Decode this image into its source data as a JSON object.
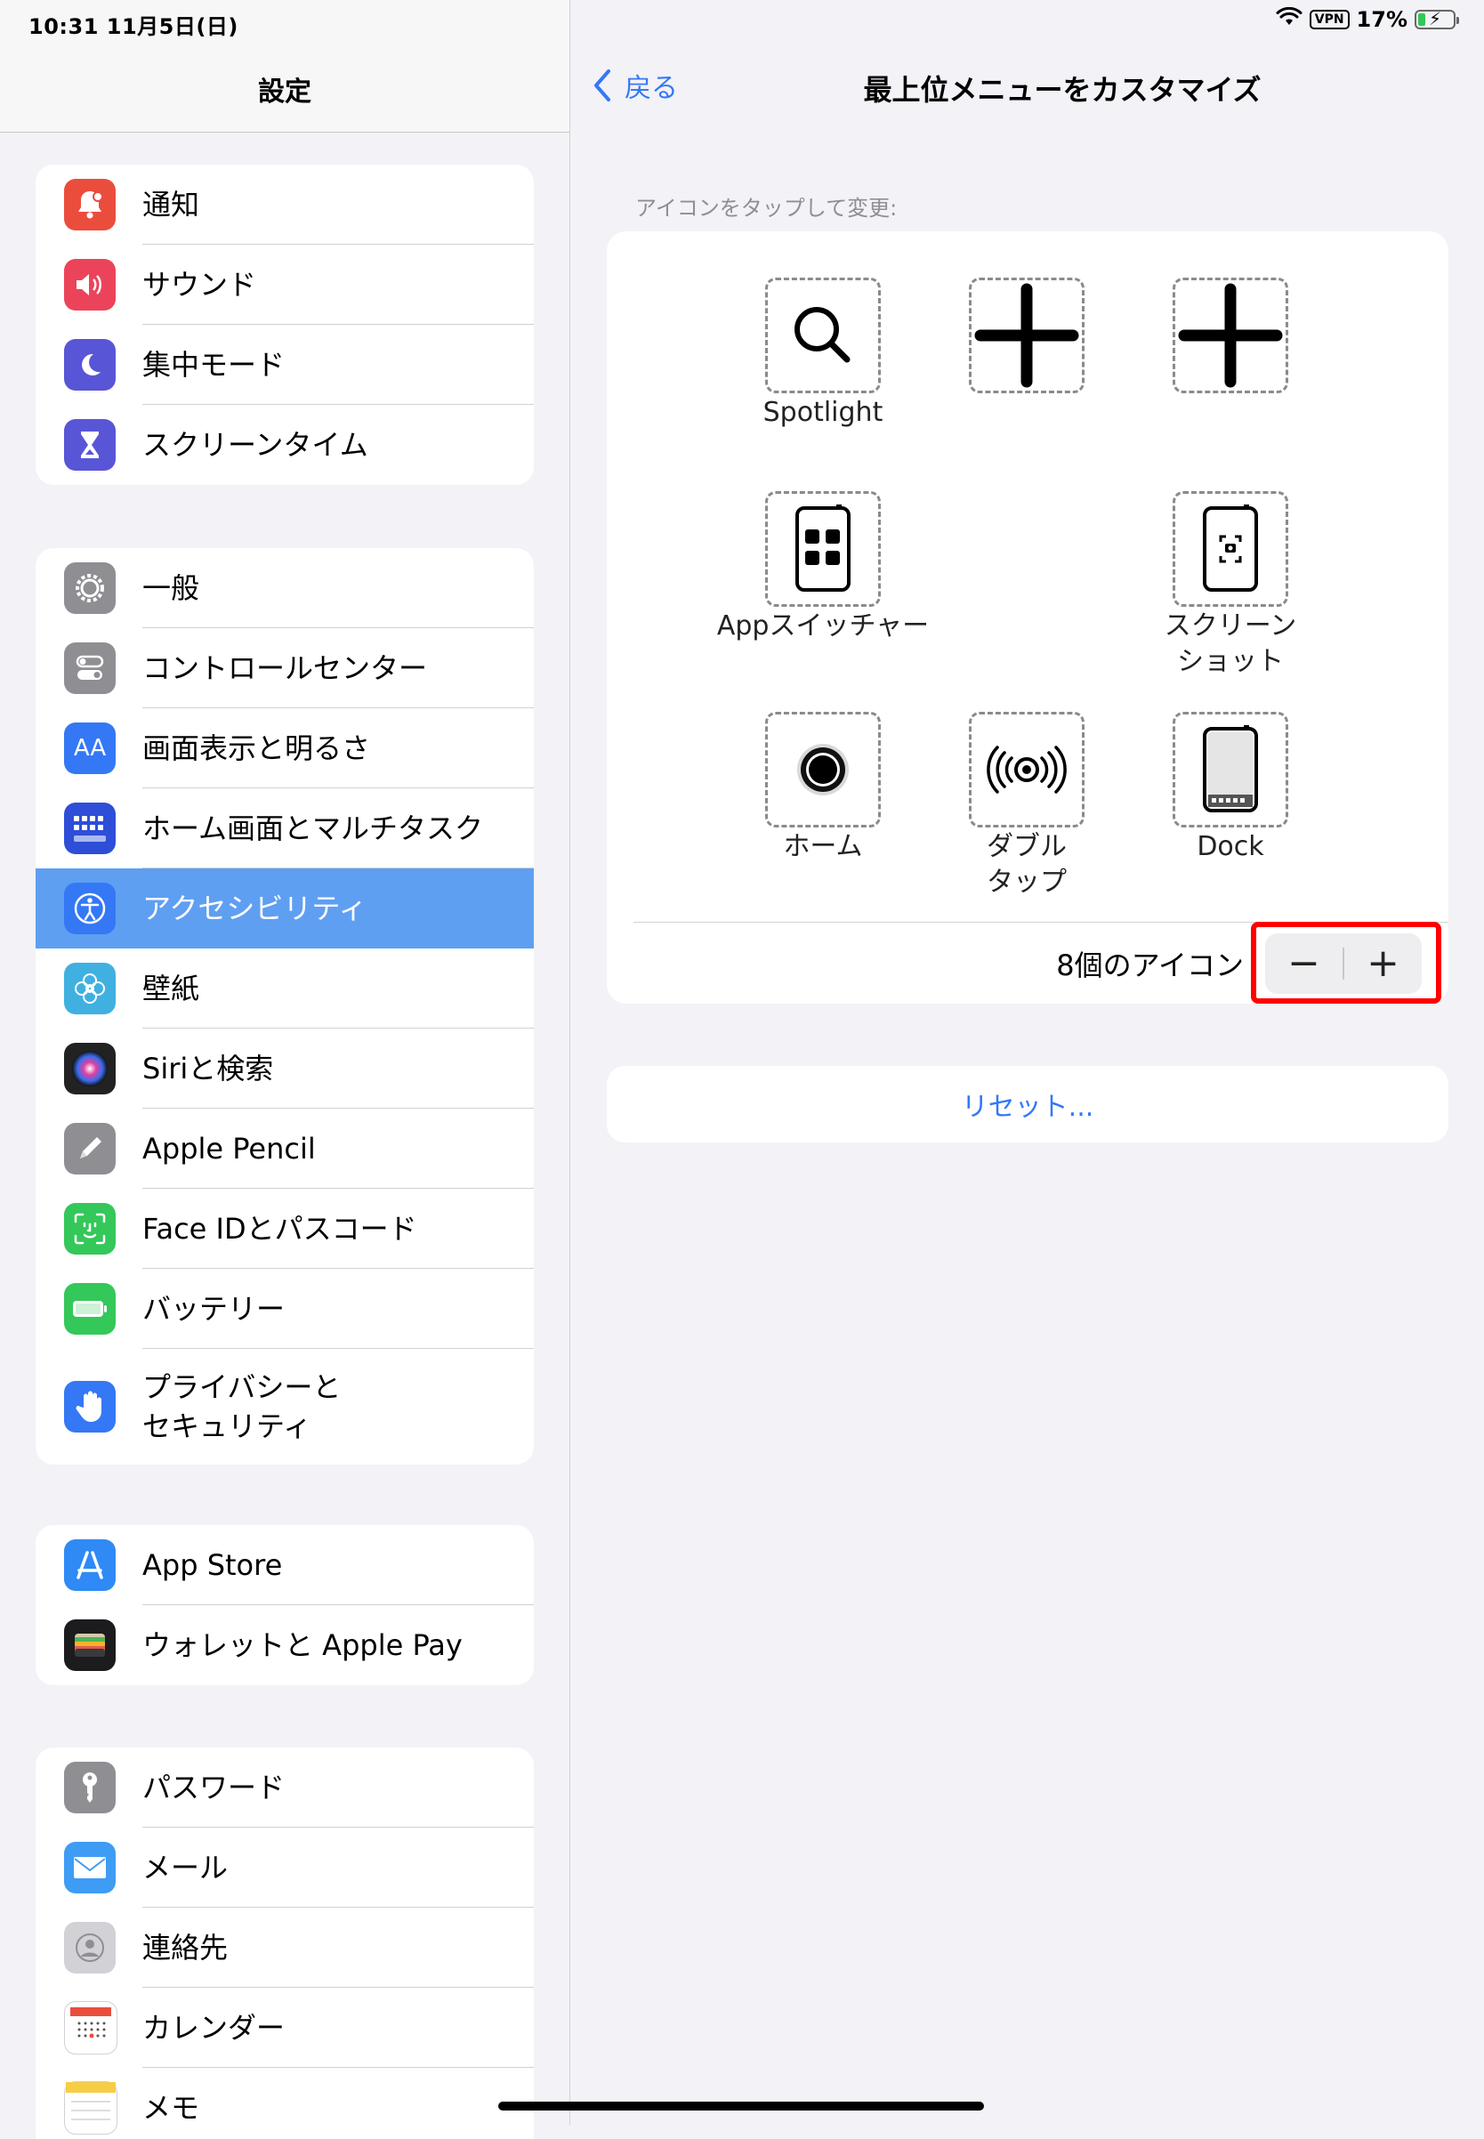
{
  "status": {
    "time_date": "10:31   11月5日(日)",
    "vpn": "VPN",
    "battery_percent": "17%"
  },
  "sidebar": {
    "title": "設定",
    "groups": [
      {
        "items": [
          {
            "label": "通知",
            "icon": "bell-icon",
            "color": "#eb4d3d"
          },
          {
            "label": "サウンド",
            "icon": "speaker-icon",
            "color": "#eb445a"
          },
          {
            "label": "集中モード",
            "icon": "moon-icon",
            "color": "#5856d6"
          },
          {
            "label": "スクリーンタイム",
            "icon": "hourglass-icon",
            "color": "#5856d6"
          }
        ]
      },
      {
        "items": [
          {
            "label": "一般",
            "icon": "gear-icon",
            "color": "#8e8e93"
          },
          {
            "label": "コントロールセンター",
            "icon": "toggles-icon",
            "color": "#8e8e93"
          },
          {
            "label": "画面表示と明るさ",
            "icon": "text-size-icon",
            "color": "#3478f6"
          },
          {
            "label": "ホーム画面とマルチタスク",
            "icon": "grid-icon",
            "color": "#2e4ed8"
          },
          {
            "label": "アクセシビリティ",
            "icon": "accessibility-icon",
            "color": "#3478f6",
            "selected": true
          },
          {
            "label": "壁紙",
            "icon": "flower-icon",
            "color": "#40b0e0"
          },
          {
            "label": "Siriと検索",
            "icon": "siri-icon",
            "color": "#222222"
          },
          {
            "label": "Apple Pencil",
            "icon": "pencil-icon",
            "color": "#8e8e93"
          },
          {
            "label": "Face IDとパスコード",
            "icon": "face-id-icon",
            "color": "#34c759"
          },
          {
            "label": "バッテリー",
            "icon": "battery-icon",
            "color": "#34c759"
          },
          {
            "label": "プライバシーと\nセキュリティ",
            "icon": "hand-icon",
            "color": "#3478f6"
          }
        ]
      },
      {
        "items": [
          {
            "label": "App Store",
            "icon": "app-store-icon",
            "color": "#2f8af5"
          },
          {
            "label": "ウォレットと Apple Pay",
            "icon": "wallet-icon",
            "color": "#1c1c1e"
          }
        ]
      },
      {
        "items": [
          {
            "label": "パスワード",
            "icon": "key-icon",
            "color": "#8e8e93"
          },
          {
            "label": "メール",
            "icon": "mail-icon",
            "color": "#3e9cf5"
          },
          {
            "label": "連絡先",
            "icon": "contacts-icon",
            "color": "#b0b0b5"
          },
          {
            "label": "カレンダー",
            "icon": "calendar-icon",
            "color": "#ffffff"
          },
          {
            "label": "メモ",
            "icon": "notes-icon",
            "color": "#ffffff"
          }
        ]
      }
    ]
  },
  "detail": {
    "back_label": "戻る",
    "title": "最上位メニューをカスタマイズ",
    "hint": "アイコンをタップして変更:",
    "slots": [
      {
        "label": "Spotlight",
        "icon": "search-icon"
      },
      {
        "label": "",
        "icon": "plus-icon"
      },
      {
        "label": "",
        "icon": "plus-icon"
      },
      {
        "label": "Appスイッチャー",
        "icon": "app-switcher-icon"
      },
      {
        "label": "スクリーン\nショット",
        "icon": "screenshot-icon"
      },
      {
        "label": "ホーム",
        "icon": "home-button-icon"
      },
      {
        "label": "ダブル\nタップ",
        "icon": "double-tap-icon"
      },
      {
        "label": "Dock",
        "icon": "dock-icon"
      }
    ],
    "count_label": "8個のアイコン",
    "stepper": {
      "minus": "−",
      "plus": "+"
    },
    "reset_label": "リセット..."
  }
}
